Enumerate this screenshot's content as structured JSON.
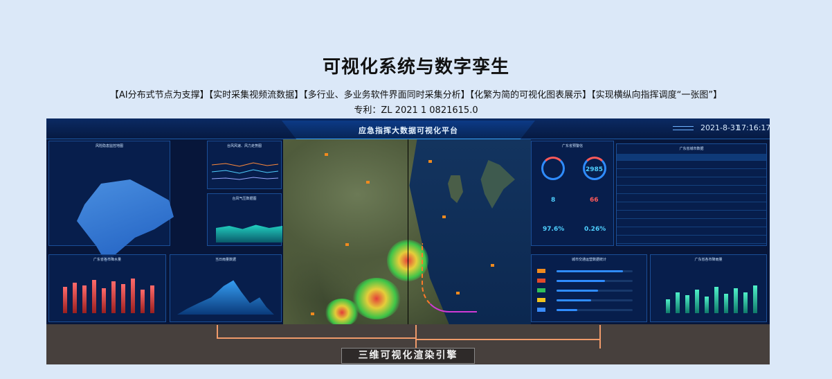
{
  "page": {
    "title": "可视化系统与数字孪生",
    "subtitle": "【AI分布式节点为支撑】【实时采集视频流数据】【多行业、多业务软件界面同时采集分析】【化繁为简的可视化图表展示】【实现横纵向指挥调度“一张图”】",
    "patent": "专利：ZL 2021 1 0821615.0"
  },
  "dashboard": {
    "system_title": "应急指挥大数据可视化平台",
    "date": "2021-8-31",
    "time": "17:16:17",
    "left_top_panel_title": "风险隐患监控地图",
    "mid_top_panel_title": "台风风速、风力走势图",
    "mid_mid_panel_title": "台风气压数据图",
    "left_bottom_panel_title": "广东省各市降水量",
    "mid_bottom_panel_title": "当日雨量数据",
    "right_top_panel_title": "广东省预警信",
    "right_table_title": "广东省城市数据",
    "right_mid_panel_title": "城市交通运营数据统计",
    "right_bottom_panel_title": "广东省各市降雨量",
    "kpis": [
      {
        "value": "2985",
        "color": "#4fd0ff"
      },
      {
        "value": "8",
        "color": "#4fd0ff"
      },
      {
        "value": "66",
        "color": "#ff5a5a"
      },
      {
        "value": "97.6%",
        "color": "#4fd0ff"
      },
      {
        "value": "0.26%",
        "color": "#4fd0ff"
      }
    ]
  },
  "engine_label": "三维可视化渲染引擎",
  "colors": {
    "background": "#dbe8f8",
    "screen": "#07163a",
    "frame": "#47403d",
    "bracket": "#f09a6a"
  }
}
